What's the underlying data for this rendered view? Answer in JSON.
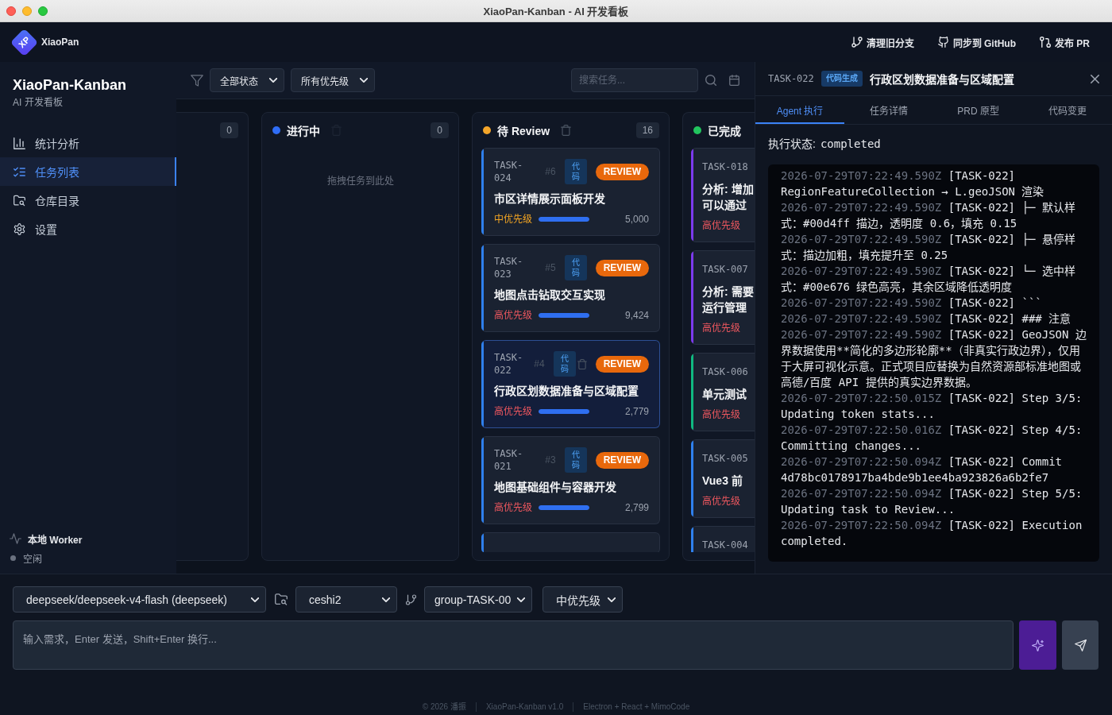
{
  "window": {
    "title": "XiaoPan-Kanban - AI 开发看板"
  },
  "header": {
    "logo_text": "XP",
    "brand": "XiaoPan",
    "actions": [
      {
        "label": "清理旧分支"
      },
      {
        "label": "同步到 GitHub"
      },
      {
        "label": "发布 PR"
      }
    ]
  },
  "sidebar": {
    "title": "XiaoPan-Kanban",
    "subtitle": "AI 开发看板",
    "items": [
      {
        "label": "统计分析",
        "selected": false
      },
      {
        "label": "任务列表",
        "selected": true
      },
      {
        "label": "仓库目录",
        "selected": false
      },
      {
        "label": "设置",
        "selected": false
      }
    ],
    "worker": {
      "label": "本地 Worker",
      "status": "空闲"
    }
  },
  "toolbar": {
    "status_filter": "全部状态",
    "priority_filter": "所有优先级",
    "search": {
      "placeholder": "搜索任务..."
    }
  },
  "board": {
    "columns": [
      {
        "count": "0"
      },
      {
        "title": "进行中",
        "color": "#2f6df6",
        "clear_disabled": true,
        "count": "0",
        "empty_text": "拖拽任务到此处"
      },
      {
        "title": "待 Review",
        "color": "#f4a62a",
        "clear_disabled": false,
        "count": "16",
        "cards": [
          {
            "id": "TASK-024",
            "number": "#6",
            "tag": "代码",
            "badge": "REVIEW",
            "title": "市区详情展示面板开发",
            "priority": "中优先级",
            "high_priority": false,
            "level": 1,
            "tokens": "5,000",
            "color": "#2f80ed",
            "selected": false,
            "hovered": false
          },
          {
            "id": "TASK-023",
            "number": "#5",
            "tag": "代码",
            "badge": "REVIEW",
            "title": "地图点击钻取交互实现",
            "priority": "高优先级",
            "high_priority": true,
            "level": 1,
            "tokens": "9,424",
            "color": "#2f80ed",
            "selected": false,
            "hovered": false
          },
          {
            "id": "TASK-022",
            "number": "#4",
            "tag": "代码",
            "badge": "REVIEW",
            "title": "行政区划数据准备与区域配置",
            "priority": "高优先级",
            "high_priority": true,
            "level": 1,
            "tokens": "2,779",
            "color": "#2f80ed",
            "selected": true,
            "hovered": true
          },
          {
            "id": "TASK-021",
            "number": "#3",
            "tag": "代码",
            "badge": "REVIEW",
            "title": "地图基础组件与容器开发",
            "priority": "高优先级",
            "high_priority": true,
            "level": 1,
            "tokens": "2,799",
            "color": "#2f80ed",
            "selected": false,
            "hovered": false
          },
          {
            "color": "#2f80ed",
            "selected": false,
            "hovered": false
          }
        ]
      },
      {
        "title": "已完成",
        "color": "#22c55e",
        "cards": [
          {
            "id": "TASK-018",
            "title": "分析: 增加可以通过",
            "priority": "高优先级",
            "high_priority": true,
            "color": "#7c3aed",
            "selected": false,
            "hovered": false
          },
          {
            "id": "TASK-007",
            "title": "分析: 需要运行管理",
            "priority": "高优先级",
            "high_priority": true,
            "color": "#7c3aed",
            "selected": false,
            "hovered": false
          },
          {
            "id": "TASK-006",
            "title": "单元测试",
            "priority": "高优先级",
            "high_priority": true,
            "color": "#10b981",
            "selected": false,
            "hovered": false
          },
          {
            "id": "TASK-005",
            "title": "Vue3 前",
            "priority": "高优先级",
            "high_priority": true,
            "color": "#2f80ed",
            "selected": false,
            "hovered": false
          },
          {
            "id": "TASK-004",
            "color": "#2f80ed",
            "selected": false,
            "hovered": false
          }
        ]
      }
    ]
  },
  "panel": {
    "task_id": "TASK-022",
    "tag": "代码生成",
    "title": "行政区划数据准备与区域配置",
    "tabs": [
      {
        "label": "Agent 执行",
        "selected": true
      },
      {
        "label": "任务详情",
        "selected": false
      },
      {
        "label": "PRD 原型",
        "selected": false
      },
      {
        "label": "代码变更",
        "selected": false
      }
    ],
    "status": {
      "label": "执行状态:",
      "value": "completed"
    },
    "log": [
      {
        "time": "2026-07-29T07:22:49.590Z",
        "text": "[TASK-022] RegionFeatureCollection → L.geoJSON 渲染"
      },
      {
        "time": "2026-07-29T07:22:49.590Z",
        "text": "[TASK-022] ├─ 默认样式：#00d4ff 描边，透明度 0.6，填充 0.15"
      },
      {
        "time": "2026-07-29T07:22:49.590Z",
        "text": "[TASK-022] ├─ 悬停样式：描边加粗，填充提升至 0.25"
      },
      {
        "time": "2026-07-29T07:22:49.590Z",
        "text": "[TASK-022] └─ 选中样式：#00e676 绿色高亮，其余区域降低透明度"
      },
      {
        "time": "2026-07-29T07:22:49.590Z",
        "text": "[TASK-022] ```"
      },
      {
        "time": "2026-07-29T07:22:49.590Z",
        "text": "[TASK-022] ### 注意"
      },
      {
        "time": "2026-07-29T07:22:49.590Z",
        "text": "[TASK-022] GeoJSON 边界数据使用**简化的多边形轮廓**（非真实行政边界），仅用于大屏可视化示意。正式项目应替换为自然资源部标准地图或高德/百度 API 提供的真实边界数据。"
      },
      {
        "time": "2026-07-29T07:22:50.015Z",
        "text": "[TASK-022] Step 3/5: Updating token stats..."
      },
      {
        "time": "2026-07-29T07:22:50.016Z",
        "text": "[TASK-022] Step 4/5: Committing changes..."
      },
      {
        "time": "2026-07-29T07:22:50.094Z",
        "text": "[TASK-022] Commit 4d78bc0178917ba4bde9b1ee4ba923826a6b2fe7"
      },
      {
        "time": "2026-07-29T07:22:50.094Z",
        "text": "[TASK-022] Step 5/5: Updating task to Review..."
      },
      {
        "time": "2026-07-29T07:22:50.094Z",
        "text": "[TASK-022] Execution completed."
      }
    ]
  },
  "composer": {
    "model": "deepseek/deepseek-v4-flash (deepseek)",
    "repo": "ceshi2",
    "branch": "group-TASK-00",
    "priority": "中优先级",
    "input": {
      "placeholder": "输入需求，Enter 发送，Shift+Enter 换行..."
    }
  },
  "footer": [
    "© 2026 潘振",
    "XiaoPan-Kanban v1.0",
    "Electron + React + MimoCode"
  ]
}
